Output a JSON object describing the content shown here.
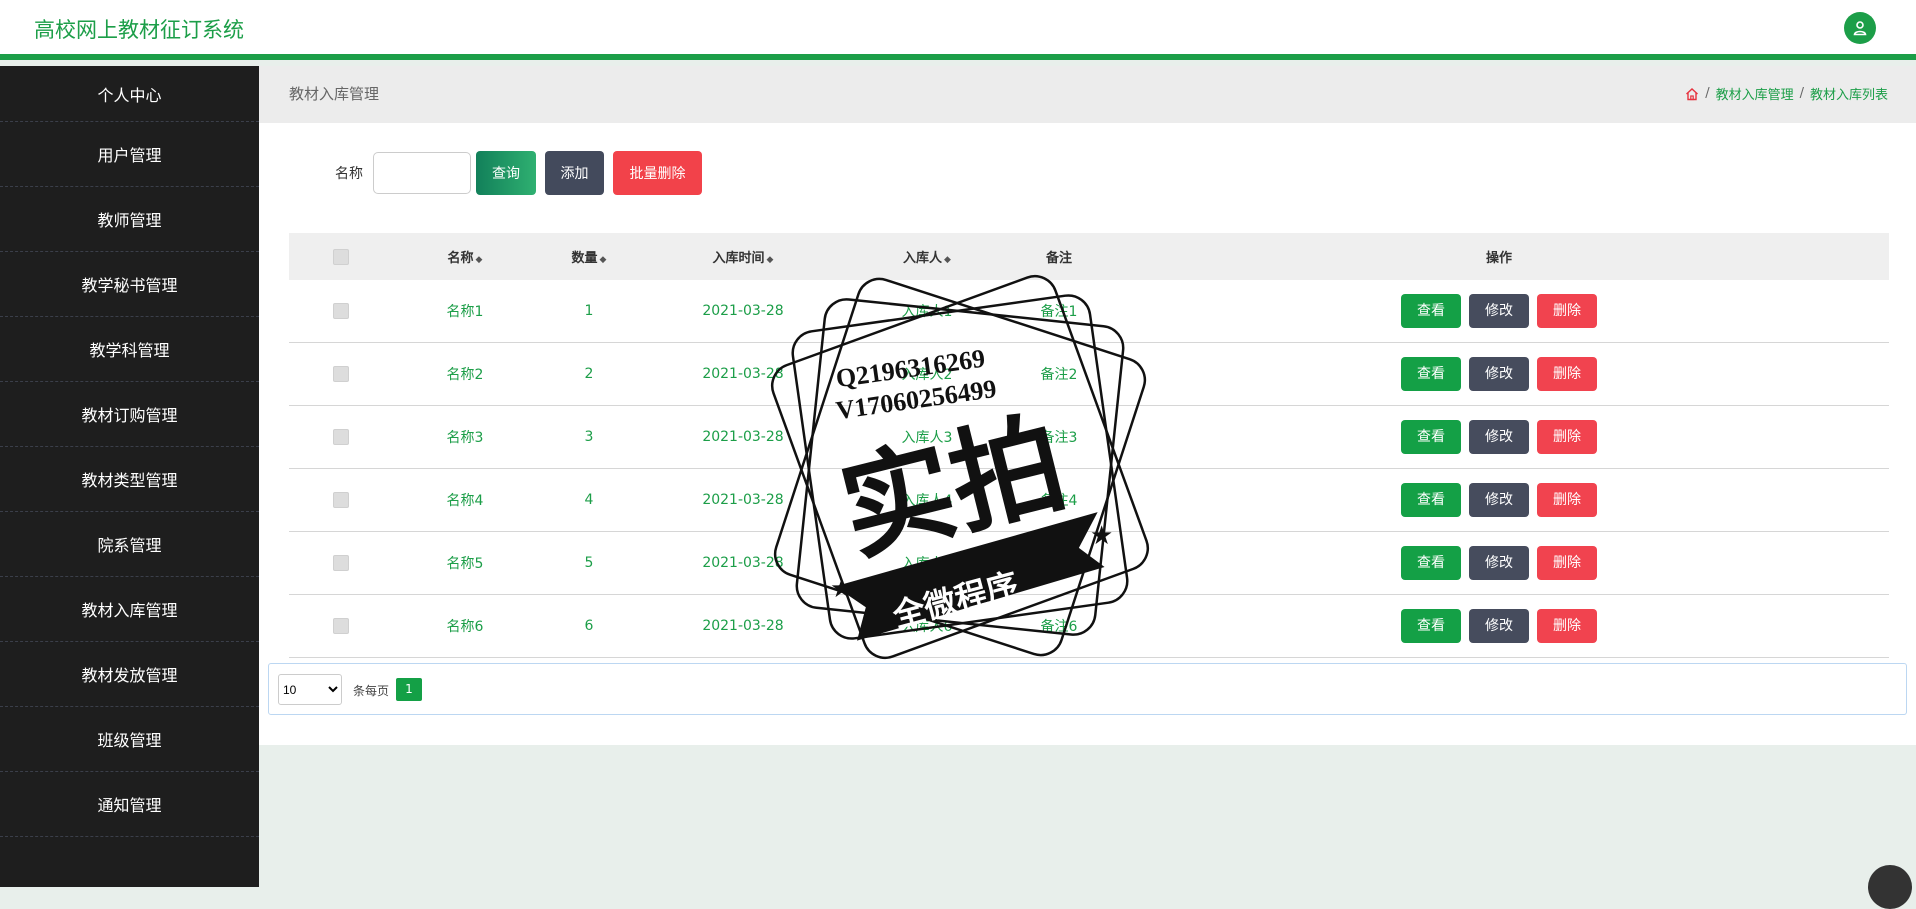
{
  "header": {
    "app_title": "高校网上教材征订系统",
    "avatar_icon": "user-icon"
  },
  "sidebar": {
    "items": [
      {
        "label": "个人中心"
      },
      {
        "label": "用户管理"
      },
      {
        "label": "教师管理"
      },
      {
        "label": "教学秘书管理"
      },
      {
        "label": "教学科管理"
      },
      {
        "label": "教材订购管理"
      },
      {
        "label": "教材类型管理"
      },
      {
        "label": "院系管理"
      },
      {
        "label": "教材入库管理"
      },
      {
        "label": "教材发放管理"
      },
      {
        "label": "班级管理"
      },
      {
        "label": "通知管理"
      }
    ]
  },
  "page": {
    "title": "教材入库管理",
    "breadcrumb": [
      "教材入库管理",
      "教材入库列表"
    ],
    "breadcrumb_sep": "/"
  },
  "search": {
    "label": "名称",
    "value": "",
    "placeholder": "",
    "query_label": "查询",
    "add_label": "添加",
    "batch_delete_label": "批量删除"
  },
  "table": {
    "columns": [
      "名称",
      "数量",
      "入库时间",
      "入库人",
      "备注",
      "操作"
    ],
    "rows": [
      {
        "name": "名称1",
        "qty": "1",
        "time": "2021-03-28",
        "person": "入库人1",
        "note": "备注1"
      },
      {
        "name": "名称2",
        "qty": "2",
        "time": "2021-03-28",
        "person": "入库人2",
        "note": "备注2"
      },
      {
        "name": "名称3",
        "qty": "3",
        "time": "2021-03-28",
        "person": "入库人3",
        "note": "备注3"
      },
      {
        "name": "名称4",
        "qty": "4",
        "time": "2021-03-28",
        "person": "入库人4",
        "note": "备注4"
      },
      {
        "name": "名称5",
        "qty": "5",
        "time": "2021-03-28",
        "person": "入库人5",
        "note": "备注5"
      },
      {
        "name": "名称6",
        "qty": "6",
        "time": "2021-03-28",
        "person": "入库人6",
        "note": "备注6"
      }
    ],
    "actions": {
      "view": "查看",
      "edit": "修改",
      "delete": "删除"
    }
  },
  "pagination": {
    "page_size": "10",
    "per_page_label": "条每页",
    "current_page": "1"
  },
  "watermark": {
    "line1": "Q2196316269",
    "line2": "V17060256499",
    "main": "实拍",
    "ribbon": "全微程序"
  },
  "colors": {
    "accent": "#1c9e48",
    "sidebar_bg": "#1e1e1e",
    "danger": "#f1434f",
    "neutral_button": "#464c5d"
  }
}
